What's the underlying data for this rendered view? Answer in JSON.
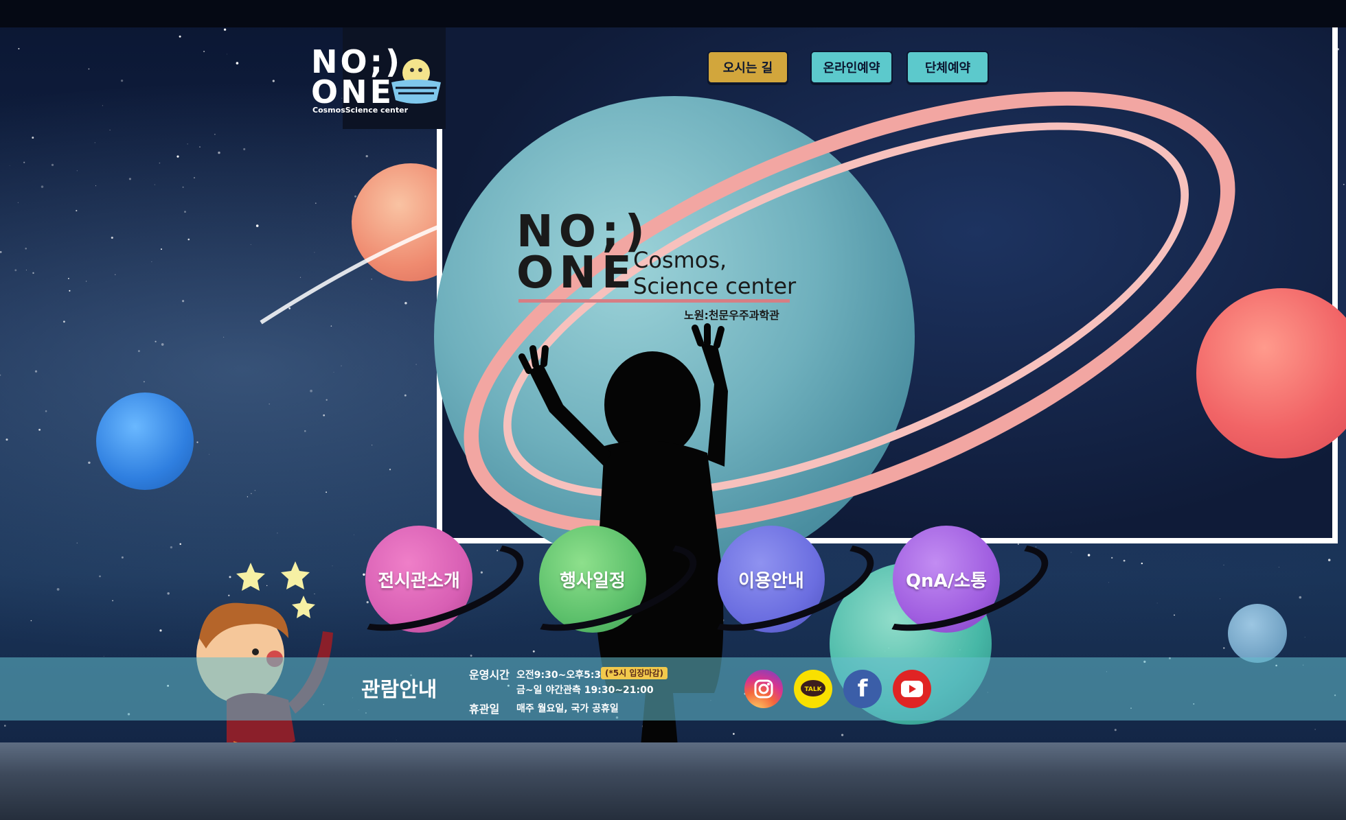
{
  "header": {
    "logo_text_line1": "NO;)",
    "logo_text_line2": "ONE",
    "logo_sub": "CosmosScience center",
    "buttons": [
      {
        "label": "오시는 길",
        "color": "#d2a63c"
      },
      {
        "label": "온라인예약",
        "color": "#5cc9cc"
      },
      {
        "label": "단체예약",
        "color": "#5cc9cc"
      }
    ]
  },
  "hero": {
    "title_line1": "NO;)",
    "title_line2": "ONE",
    "subtitle_line1": "Cosmos,",
    "subtitle_line2": "Science center",
    "korean_name": "노원:천문우주과학관"
  },
  "nav": {
    "items": [
      {
        "label": "전시관소개",
        "color": "#d85fb4"
      },
      {
        "label": "행사일정",
        "color": "#5cc06b"
      },
      {
        "label": "이용안내",
        "color": "#6b6ee0"
      },
      {
        "label": "QnA/소통",
        "color": "#a05ee0"
      }
    ]
  },
  "info": {
    "title": "관람안내",
    "hours_label": "운영시간",
    "hours_value": "오전9:30~오후5:30",
    "hours_note": "(*5시 입장마감)",
    "night_value": "금~일 야간관측 19:30~21:00",
    "closed_label": "휴관일",
    "closed_value": "매주 월요일, 국가 공휴일"
  },
  "social": [
    {
      "icon": "instagram-icon"
    },
    {
      "icon": "kakaotalk-icon",
      "label": "TALK"
    },
    {
      "icon": "facebook-icon",
      "label": "f"
    },
    {
      "icon": "youtube-icon"
    }
  ]
}
